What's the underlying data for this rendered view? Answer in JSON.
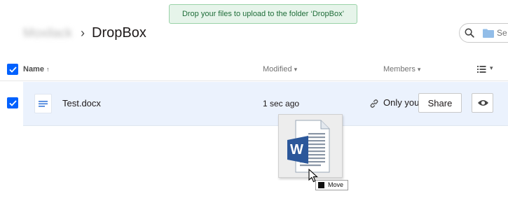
{
  "banner": {
    "message": "Drop your files to upload to the folder ‘DropBox’"
  },
  "breadcrumb": {
    "parent": "Moxilack",
    "separator": "›",
    "current": "DropBox"
  },
  "search": {
    "placeholder": "Se"
  },
  "columns": {
    "name": "Name",
    "name_sort": "↑",
    "modified": "Modified",
    "members": "Members",
    "dropdown": "▾"
  },
  "files": [
    {
      "name": "Test.docx",
      "modified": "1 sec ago",
      "members": "Only you",
      "share_label": "Share",
      "selected": true
    }
  ],
  "drag": {
    "tooltip": "Move",
    "app_letter": "W"
  },
  "colors": {
    "accent": "#0061fe",
    "selected_row": "#ebf2fd",
    "word_blue": "#2b579a"
  }
}
